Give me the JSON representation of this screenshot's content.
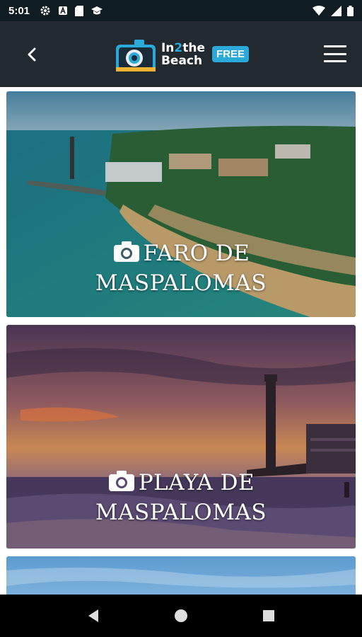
{
  "status_bar": {
    "time": "5:01"
  },
  "header": {
    "logo_line1_a": "In",
    "logo_line1_b": "2",
    "logo_line1_c": "the",
    "logo_line2": "Beach",
    "badge": "FREE"
  },
  "cards": [
    {
      "title_line1": "FARO DE",
      "title_line2": "MASPALOMAS"
    },
    {
      "title_line1": "PLAYA DE",
      "title_line2": "MASPALOMAS"
    }
  ]
}
